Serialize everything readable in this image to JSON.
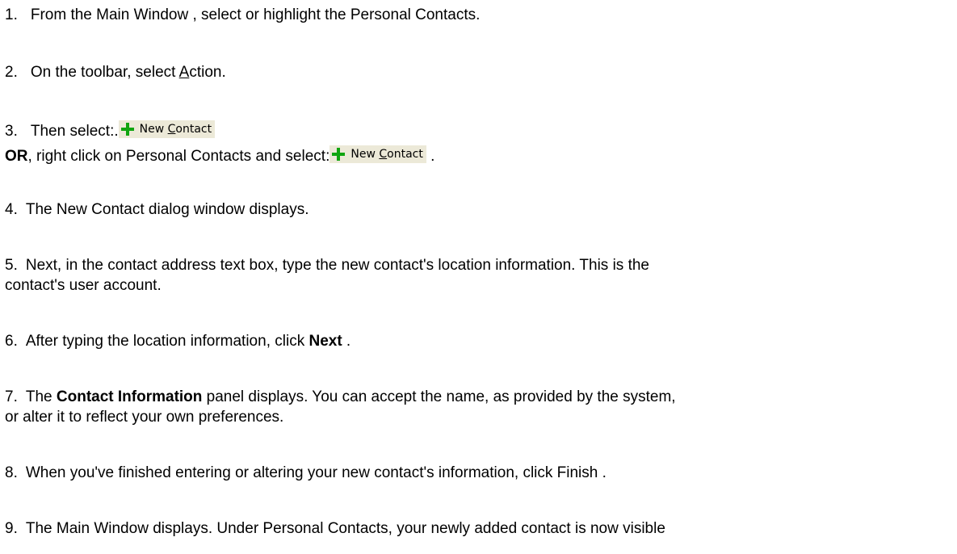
{
  "steps": {
    "s1": {
      "num": "1.",
      "text": "From the Main Window , select or highlight the Personal Contacts."
    },
    "s2": {
      "num": "2.",
      "pre": "On the toolbar, select ",
      "underline": "A",
      "post": "ction."
    },
    "s3": {
      "num": "3.",
      "text": "Then select:."
    },
    "or_line": {
      "bold": "OR",
      "text": ", right click on Personal Contacts and select:",
      "after": " ."
    },
    "s4": {
      "num": "4.",
      "text": "The New Contact dialog window displays."
    },
    "s5": {
      "num": "5.",
      "line1": "Next, in the contact address text box, type the new contact's location information. This is the",
      "line2": "contact's user account."
    },
    "s6": {
      "num": "6.",
      "pre": "After typing the location information, click ",
      "bold": "Next",
      "post": " ."
    },
    "s7": {
      "num": "7.",
      "pre": "The ",
      "bold": "Contact Information",
      "post": " panel displays. You can accept the name, as provided by the system,",
      "line2": "or alter it to reflect your own preferences."
    },
    "s8": {
      "num": "8.",
      "text": "When you've finished entering or altering your new contact's information, click Finish ."
    },
    "s9": {
      "num": "9.",
      "text": "The Main Window displays. Under Personal Contacts, your newly added contact is now visible"
    }
  },
  "new_contact_button": {
    "icon": "plus-icon",
    "icon_color": "#10a510",
    "label_pre": "New ",
    "label_underline": "C",
    "label_post": "ontact"
  }
}
